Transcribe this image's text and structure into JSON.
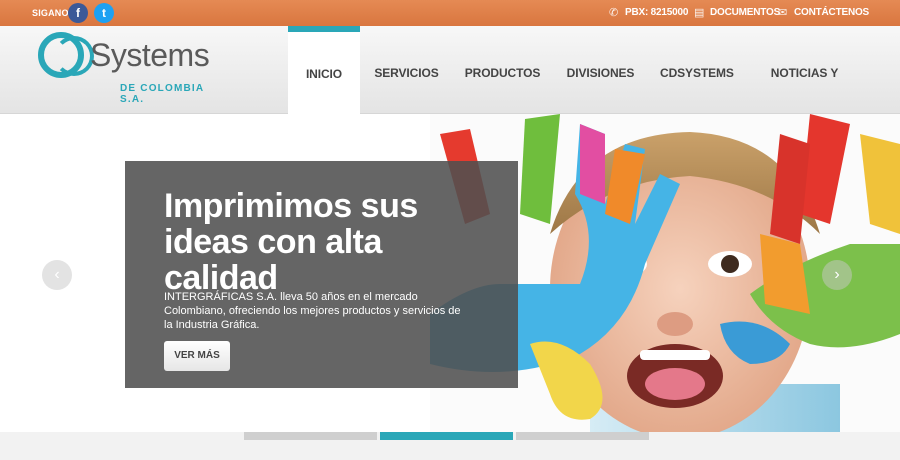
{
  "topbar": {
    "follow_label": "SIGANOS",
    "facebook_glyph": "f",
    "twitter_glyph": "t",
    "phone": "PBX: 8215000",
    "documents": "DOCUMENTOS",
    "contact": "CONTÁCTENOS"
  },
  "logo": {
    "name": "Systems",
    "subtitle": "DE COLOMBIA S.A."
  },
  "nav": [
    {
      "label": "INICIO",
      "active": true
    },
    {
      "label": "SERVICIOS"
    },
    {
      "label": "PRODUCTOS"
    },
    {
      "label": "DIVISIONES"
    },
    {
      "label": "CDSYSTEMS"
    },
    {
      "label": "NOTICIAS Y TIPS"
    }
  ],
  "slide": {
    "title": "Imprimimos sus ideas con alta calidad",
    "text": "INTERGRÁFICAS S.A. lleva 50 años en el mercado Colombiano, ofreciendo los mejores productos y servicios de la Industria Gráfica.",
    "button": "VER MÁS",
    "prev_glyph": "‹",
    "next_glyph": "›"
  },
  "slider": {
    "count": 3,
    "active_index": 1
  },
  "colors": {
    "accent": "#2aa7b8",
    "topbar": "#d9763f"
  }
}
